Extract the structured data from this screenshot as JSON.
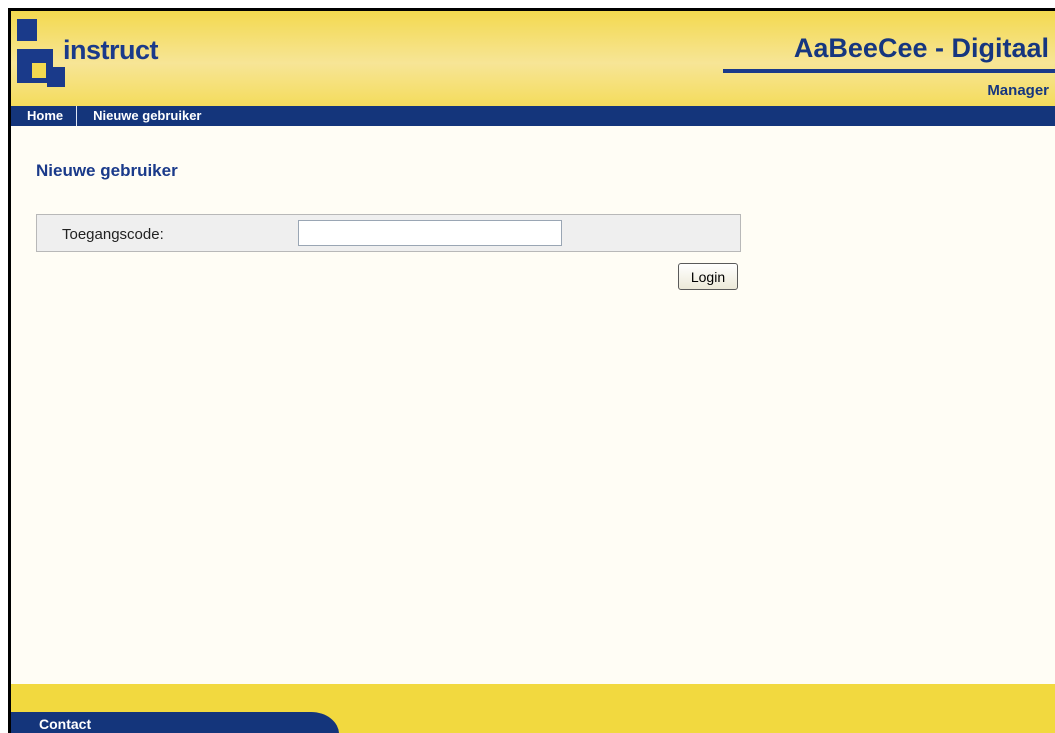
{
  "brand": {
    "logo_text": "instruct",
    "app_title": "AaBeeCee - Digitaal",
    "subtitle": "Manager"
  },
  "nav": {
    "items": [
      {
        "label": "Home"
      },
      {
        "label": "Nieuwe gebruiker"
      }
    ]
  },
  "main": {
    "page_title": "Nieuwe gebruiker",
    "form": {
      "field_label": "Toegangscode:",
      "field_value": "",
      "field_placeholder": "",
      "submit_label": "Login"
    }
  },
  "footer": {
    "contact_label": "Contact"
  },
  "colors": {
    "brand_blue": "#14357b",
    "header_yellow": "#f3d94f",
    "page_background": "#fffdf5"
  }
}
